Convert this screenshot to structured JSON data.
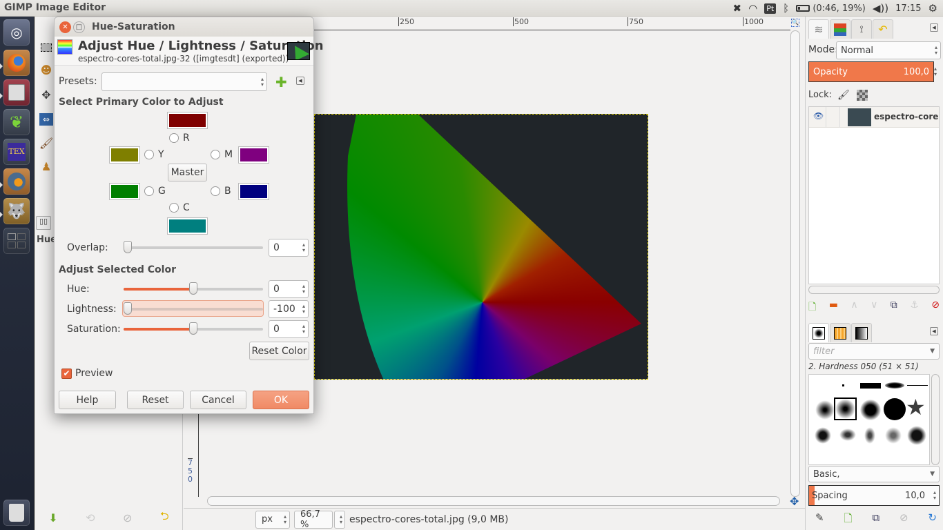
{
  "topbar": {
    "app_title": "GIMP Image Editor",
    "keyboard_layout": "Pt",
    "battery": "(0:46, 19%)",
    "clock": "17:15"
  },
  "launcher": {
    "items": [
      "Ubuntu Dash",
      "Firefox",
      "Files",
      "MComix",
      "TeXworks",
      "Cura",
      "GIMP",
      "Workspaces"
    ],
    "trash": "Trash"
  },
  "toolbox": {
    "tab_label": "Hue-"
  },
  "ruler": {
    "h_ticks": [
      "250",
      "500",
      "750",
      "1000"
    ],
    "v_ticks": [
      "7",
      "5",
      "0"
    ]
  },
  "status": {
    "unit": "px",
    "zoom": "66,7 %",
    "file_info": "espectro-cores-total.jpg (9,0 MB)"
  },
  "dialog": {
    "window_title": "Hue-Saturation",
    "heading": "Adjust Hue / Lightness / Saturation",
    "subheading": "espectro-cores-total.jpg-32 ([imgtesdt] (exported))",
    "presets_label": "Presets:",
    "presets_value": "",
    "primary_header": "Select Primary Color to Adjust",
    "colors": {
      "R": {
        "label": "R",
        "hex": "#7f0000"
      },
      "Y": {
        "label": "Y",
        "hex": "#7f7f00"
      },
      "G": {
        "label": "G",
        "hex": "#007f00"
      },
      "C": {
        "label": "C",
        "hex": "#007f7f"
      },
      "B": {
        "label": "B",
        "hex": "#00007f"
      },
      "M": {
        "label": "M",
        "hex": "#7f007f"
      }
    },
    "master_label": "Master",
    "overlap_label": "Overlap:",
    "overlap_value": "0",
    "adjust_header": "Adjust Selected Color",
    "hue_label": "Hue:",
    "hue_value": "0",
    "lightness_label": "Lightness:",
    "lightness_value": "-100",
    "saturation_label": "Saturation:",
    "saturation_value": "0",
    "reset_color": "Reset Color",
    "preview_label": "Preview",
    "preview_checked": true,
    "buttons": {
      "help": "Help",
      "reset": "Reset",
      "cancel": "Cancel",
      "ok": "OK"
    }
  },
  "layers": {
    "mode_label": "Mode:",
    "mode_value": "Normal",
    "opacity_label": "Opacity",
    "opacity_value": "100,0",
    "lock_label": "Lock:",
    "layer_name": "espectro-cores-te"
  },
  "brushes": {
    "filter_placeholder": "filter",
    "selected_brush": "2. Hardness 050 (51 × 51)",
    "tag_value": "Basic,",
    "spacing_label": "Spacing",
    "spacing_value": "10,0"
  },
  "accent_color": "#f0784a"
}
